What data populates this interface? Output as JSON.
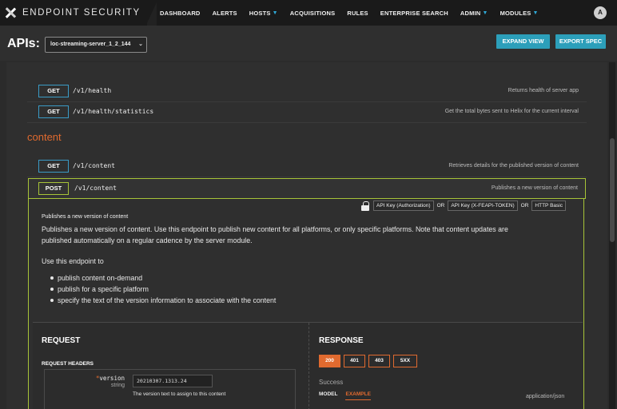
{
  "nav": {
    "brand": "ENDPOINT SECURITY",
    "items": [
      {
        "label": "DASHBOARD",
        "has_menu": false
      },
      {
        "label": "ALERTS",
        "has_menu": false
      },
      {
        "label": "HOSTS",
        "has_menu": true
      },
      {
        "label": "ACQUISITIONS",
        "has_menu": false
      },
      {
        "label": "RULES",
        "has_menu": false
      },
      {
        "label": "ENTERPRISE SEARCH",
        "has_menu": false
      },
      {
        "label": "ADMIN",
        "has_menu": true
      },
      {
        "label": "MODULES",
        "has_menu": true
      }
    ],
    "user_initial": "A"
  },
  "apis_bar": {
    "label": "APIs:",
    "selected_api": "loc-streaming-server_1_2_144",
    "expand_label": "EXPAND VIEW",
    "export_label": "EXPORT SPEC"
  },
  "operations_top": [
    {
      "method": "GET",
      "path": "/v1/health",
      "description": "Returns health of server app"
    },
    {
      "method": "GET",
      "path": "/v1/health/statistics",
      "description": "Get the total bytes sent to Helix for the current interval"
    }
  ],
  "section": {
    "title": "content",
    "operations": [
      {
        "method": "GET",
        "path": "/v1/content",
        "description": "Retrieves details for the published version of content"
      }
    ]
  },
  "expanded_op": {
    "method": "POST",
    "path": "/v1/content",
    "description": "Publishes a new version of content",
    "auth": {
      "methods": [
        "API Key (Authorization)",
        "API Key (X-FEAPI-TOKEN)",
        "HTTP Basic"
      ],
      "separator": "OR"
    },
    "summary": "Publishes a new version of content",
    "body_lines": [
      "Publishes a new version of content. Use this endpoint to publish new content for all platforms, or only specific platforms. Note that content updates are",
      "published automatically on a regular cadence by the server module."
    ],
    "use_line": "Use this endpoint to",
    "bullets": [
      "publish content on-demand",
      "publish for a specific platform",
      "specify the text of the version information to associate with the content"
    ],
    "request": {
      "title": "REQUEST",
      "headers_title": "REQUEST HEADERS",
      "param": {
        "required_marker": "*",
        "name": "version",
        "type": "string",
        "value": "20210307.1313.24",
        "help": "The version text to assign to this content"
      }
    },
    "response": {
      "title": "RESPONSE",
      "codes": [
        "200",
        "401",
        "403",
        "5XX"
      ],
      "active_code": "200",
      "status_text": "Success",
      "tabs": [
        "MODEL",
        "EXAMPLE"
      ],
      "active_tab": "EXAMPLE",
      "content_type": "application/json"
    }
  }
}
